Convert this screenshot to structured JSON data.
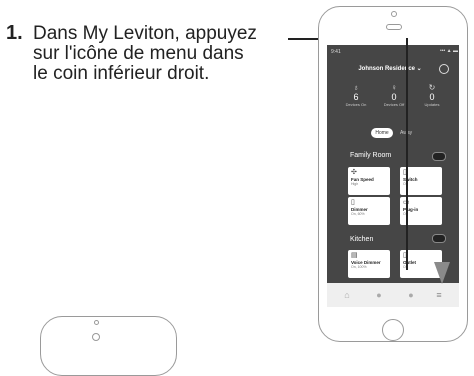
{
  "instruction": {
    "step_number": "1.",
    "line1": "Dans My Leviton, appuyez",
    "line2": "sur l'icône de menu dans",
    "line3": "le coin inférieur droit."
  },
  "app": {
    "time": "9:41",
    "status_icons": "••• ▲ ▬",
    "residence": "Johnson Residence ⌄",
    "stats": [
      {
        "icon": "bulb-icon",
        "glyph": "♁",
        "value": "6",
        "label": "Devices On"
      },
      {
        "icon": "bulb-off-icon",
        "glyph": "♀",
        "value": "0",
        "label": "Devices Off"
      },
      {
        "icon": "refresh-icon",
        "glyph": "↻",
        "value": "0",
        "label": "Updates"
      }
    ],
    "mode": {
      "active": "Home",
      "inactive": "Away"
    },
    "rooms": [
      {
        "name": "Family Room",
        "toggle_on": true,
        "devices": [
          {
            "icon": "fan-icon",
            "glyph": "✣",
            "name": "Fan Speed",
            "status": "High"
          },
          {
            "icon": "switch-icon",
            "glyph": "▯",
            "name": "Switch",
            "status": "On"
          },
          {
            "icon": "dimmer-icon",
            "glyph": "▯",
            "name": "Dimmer",
            "status": "On, 60%"
          },
          {
            "icon": "plug-icon",
            "glyph": "▭",
            "name": "Plug-in",
            "status": "On"
          }
        ]
      },
      {
        "name": "Kitchen",
        "toggle_on": true,
        "devices": [
          {
            "icon": "voice-dimmer-icon",
            "glyph": "▤",
            "name": "Voice Dimmer",
            "status": "On, 100%"
          },
          {
            "icon": "outlet-icon",
            "glyph": "▯",
            "name": "Outlet",
            "status": "On"
          }
        ]
      }
    ],
    "bottom_nav": [
      {
        "icon": "home-icon",
        "glyph": "⌂"
      },
      {
        "icon": "scenes-icon",
        "glyph": "●"
      },
      {
        "icon": "schedule-icon",
        "glyph": "●"
      },
      {
        "icon": "menu-icon",
        "glyph": "≡"
      }
    ]
  },
  "colors": {
    "screen_bg": "#464646",
    "callout": "#222222",
    "arrow": "#8a8a8a"
  }
}
